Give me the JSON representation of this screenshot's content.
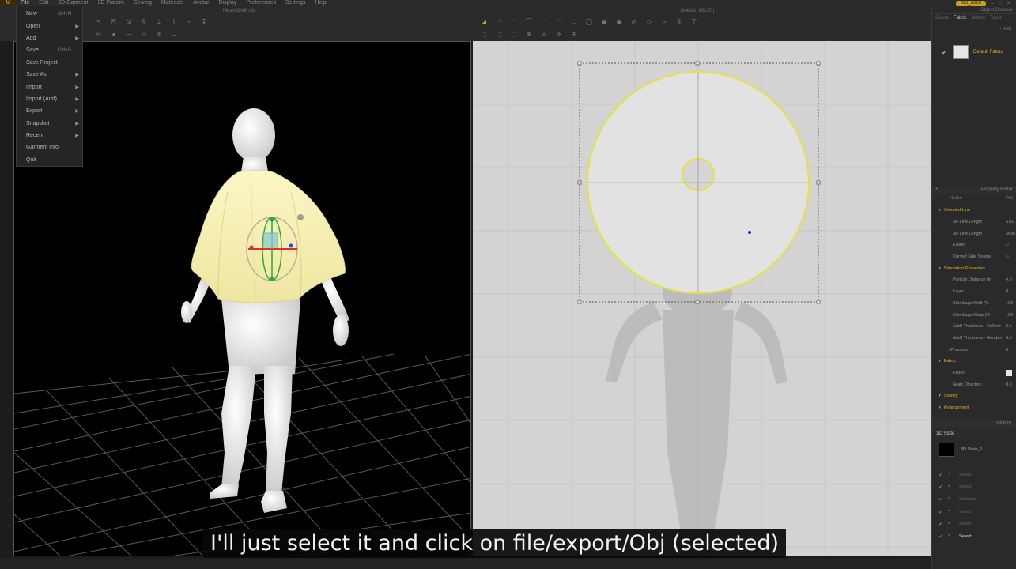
{
  "app": {
    "logo": "M",
    "menu": [
      "File",
      "Edit",
      "3D Garment",
      "2D Pattern",
      "Sewing",
      "Materials",
      "Avatar",
      "Display",
      "Preferences",
      "Settings",
      "Help"
    ],
    "active_menu": "File",
    "right_badge": "MD_2019"
  },
  "viewport_3d": {
    "title": "Mesh-Grid0.obj"
  },
  "viewport_2d": {
    "title": "Default_MD.Zfrj"
  },
  "file_menu": {
    "items": [
      {
        "label": "New",
        "shortcut": "Ctrl+N",
        "submenu": false
      },
      {
        "label": "Open",
        "shortcut": "",
        "submenu": true
      },
      {
        "label": "Add",
        "shortcut": "",
        "submenu": true
      },
      {
        "label": "Save",
        "shortcut": "Ctrl+S",
        "submenu": false
      },
      {
        "label": "Save Project",
        "shortcut": "",
        "submenu": false
      },
      {
        "label": "Save As",
        "shortcut": "",
        "submenu": true
      },
      {
        "label": "Import",
        "shortcut": "",
        "submenu": true
      },
      {
        "label": "Import (Add)",
        "shortcut": "",
        "submenu": true
      },
      {
        "label": "Export",
        "shortcut": "",
        "submenu": true
      },
      {
        "label": "Snapshot",
        "shortcut": "",
        "submenu": true
      },
      {
        "label": "Recent",
        "shortcut": "",
        "submenu": true
      },
      {
        "label": "Garment Info",
        "shortcut": "",
        "submenu": false
      },
      {
        "label": "Quit",
        "shortcut": "",
        "submenu": false
      }
    ]
  },
  "object_browser": {
    "title": "Object Browser",
    "tabs": [
      "Scene",
      "Fabric",
      "Button",
      "Topst."
    ],
    "active_tab": "Fabric",
    "add_label": "+ Add",
    "fabric_name": "Default Fabric"
  },
  "property_editor": {
    "title": "Property Editor",
    "col_name": "Name",
    "col_value": "Pat",
    "rows": [
      {
        "kind": "sec",
        "label": "Selected Line",
        "value": ""
      },
      {
        "kind": "prop",
        "label": "3D Line Length",
        "value": "3701"
      },
      {
        "kind": "prop",
        "label": "3D Line Length",
        "value": "3696"
      },
      {
        "kind": "prop",
        "label": "Elastic",
        "value": "□"
      },
      {
        "kind": "prop",
        "label": "Curved Side Seame",
        "value": "□"
      },
      {
        "kind": "sec",
        "label": "Simulation Properties",
        "value": ""
      },
      {
        "kind": "prop",
        "label": "Particle Distance (m",
        "value": "4.0"
      },
      {
        "kind": "prop",
        "label": "Layer",
        "value": "0"
      },
      {
        "kind": "prop",
        "label": "Shrinkage Weft (%",
        "value": "100"
      },
      {
        "kind": "prop",
        "label": "Shrinkage Warp (%",
        "value": "100"
      },
      {
        "kind": "prop",
        "label": "Add'l Thickness - Collisio",
        "value": "2.5"
      },
      {
        "kind": "prop",
        "label": "Add'l Thickness - Renderi",
        "value": "0.0"
      },
      {
        "kind": "sub",
        "label": "› Pressure",
        "value": "0"
      },
      {
        "kind": "sec",
        "label": "Fabric",
        "value": ""
      },
      {
        "kind": "prop",
        "label": "Fabric",
        "value": "",
        "chip": true
      },
      {
        "kind": "prop",
        "label": "Grain Direction",
        "value": "0.0"
      },
      {
        "kind": "sec",
        "label": "Solidify",
        "value": ""
      },
      {
        "kind": "sec",
        "label": "Arrangement",
        "value": ""
      }
    ]
  },
  "history": {
    "title": "History",
    "state_label": "3D State",
    "state_name": "3D State_1",
    "items": [
      {
        "label": "Select",
        "selected": false
      },
      {
        "label": "Select",
        "selected": false
      },
      {
        "label": "Simulate",
        "selected": false
      },
      {
        "label": "Select",
        "selected": false
      },
      {
        "label": "Select",
        "selected": false
      },
      {
        "label": "Select",
        "selected": true
      }
    ]
  },
  "subtitle": "I'll just select it and click on file/export/Obj (selected)"
}
